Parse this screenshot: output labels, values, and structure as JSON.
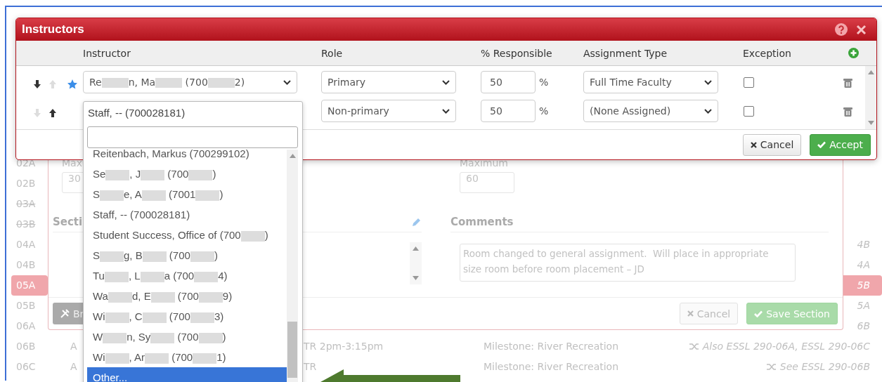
{
  "background": {
    "section_list": [
      {
        "label": "02A",
        "struck": false,
        "selected": false
      },
      {
        "label": "02B",
        "struck": false,
        "selected": false
      },
      {
        "label": "03A",
        "struck": true,
        "selected": false
      },
      {
        "label": "03B",
        "struck": true,
        "selected": false
      },
      {
        "label": "04A",
        "struck": false,
        "selected": false
      },
      {
        "label": "04B",
        "struck": false,
        "selected": false
      },
      {
        "label": "05A",
        "struck": false,
        "selected": true
      },
      {
        "label": "05B",
        "struck": false,
        "selected": false
      },
      {
        "label": "06A",
        "struck": false,
        "selected": false
      }
    ],
    "section_editor": {
      "max_label": "Max",
      "max_value": "30",
      "maximum_label": "Maximum",
      "maximum_value": "60",
      "section_heading": "Secti",
      "comments_heading": "Comments",
      "comments": "Room changed to general assignment.  Will place in appropriate size room before room placement – JD",
      "tool_button": "Br",
      "cancel_button": "Cancel",
      "save_button": "Save Section"
    },
    "right_list": [
      {
        "label": "4B",
        "selected": false
      },
      {
        "label": "4A",
        "selected": false
      },
      {
        "label": "5B",
        "selected": true
      },
      {
        "label": "5A",
        "selected": false
      },
      {
        "label": "6B",
        "selected": false
      }
    ],
    "rows": [
      {
        "section": "06B",
        "type": "A",
        "time": "TR 2pm-3:15pm",
        "title": "Milestone: River Recreation",
        "note": "Also ESSL 290-06A, ESSL 290-06C"
      },
      {
        "section": "06C",
        "type": "A",
        "time": "TR",
        "title": "Milestone: River Recreation",
        "note": "See ESSL 290-06B"
      }
    ]
  },
  "dialog": {
    "title": "Instructors",
    "columns": [
      "Instructor",
      "Role",
      "% Responsible",
      "Assignment Type",
      "Exception"
    ],
    "rows": [
      {
        "instructor_parts": [
          "Re",
          "n, Ma",
          " (700",
          "2)"
        ],
        "can_move_down": true,
        "can_move_up": false,
        "primary": true,
        "role": "Primary",
        "percent": "50",
        "unit": "%",
        "assignment_type": "Full Time Faculty",
        "exception": false
      },
      {
        "can_move_down": false,
        "can_move_up": true,
        "primary": false,
        "role": "Non-primary",
        "percent": "50",
        "unit": "%",
        "assignment_type": "(None Assigned)",
        "exception": false
      }
    ],
    "cancel_button": "Cancel",
    "accept_button": "Accept"
  },
  "dropdown": {
    "current": "Staff, -- (700028181)",
    "options": [
      {
        "parts": [
          "Reitenbach, Markus (700299102)"
        ],
        "selected": false
      },
      {
        "parts": [
          "Se",
          ", J",
          " (700",
          ")"
        ],
        "selected": false
      },
      {
        "parts": [
          "S",
          "e, A",
          " (7001",
          ")"
        ],
        "selected": false
      },
      {
        "parts": [
          "Staff, -- (700028181)"
        ],
        "selected": false
      },
      {
        "parts": [
          "Student Success, Office of (700",
          ")"
        ],
        "selected": false
      },
      {
        "parts": [
          "S",
          "g, B",
          " (700",
          ")"
        ],
        "selected": false
      },
      {
        "parts": [
          "Tu",
          ", L",
          "a (700",
          "4)"
        ],
        "selected": false
      },
      {
        "parts": [
          "Wa",
          "d, E",
          " (700",
          "9)"
        ],
        "selected": false
      },
      {
        "parts": [
          "Wi",
          ", C",
          " (700",
          "3)"
        ],
        "selected": false
      },
      {
        "parts": [
          "W",
          "n, Sy",
          " (700",
          ")"
        ],
        "selected": false
      },
      {
        "parts": [
          "Wi",
          ", Ar",
          " (700",
          "1)"
        ],
        "selected": false
      },
      {
        "parts": [
          "Other..."
        ],
        "selected": true
      }
    ]
  }
}
